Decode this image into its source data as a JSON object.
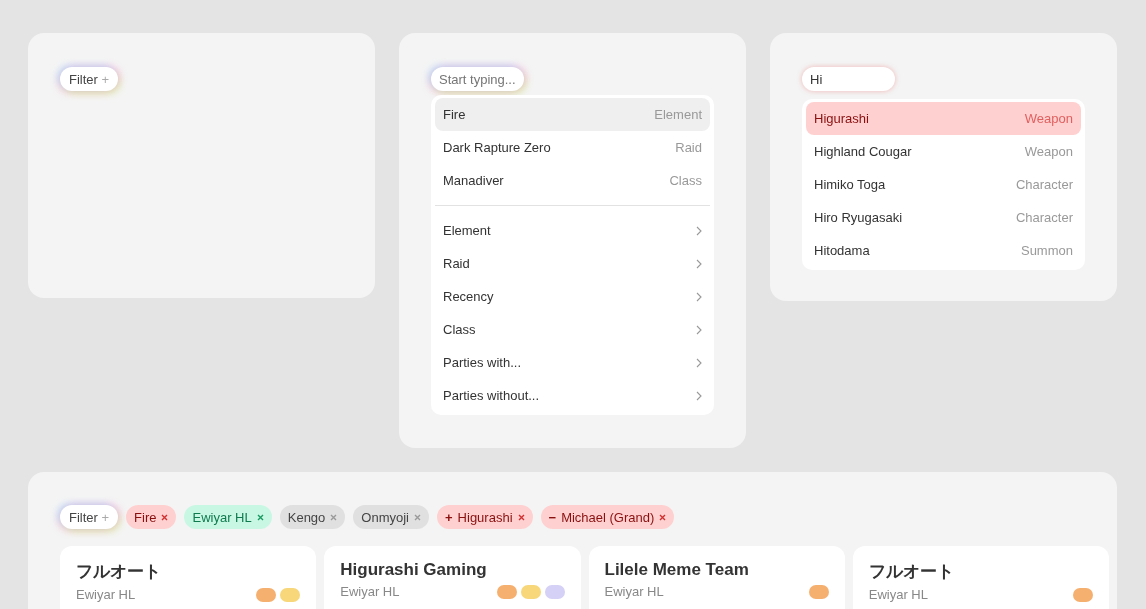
{
  "panel_empty": {
    "filter_button": {
      "label": "Filter",
      "icon": "+"
    }
  },
  "panel_menu": {
    "search": {
      "placeholder": "Start typing..."
    },
    "suggestions": [
      {
        "label": "Fire",
        "category": "Element",
        "selected": true
      },
      {
        "label": "Dark Rapture Zero",
        "category": "Raid",
        "selected": false
      },
      {
        "label": "Manadiver",
        "category": "Class",
        "selected": false
      }
    ],
    "submenus": [
      {
        "label": "Element"
      },
      {
        "label": "Raid"
      },
      {
        "label": "Recency"
      },
      {
        "label": "Class"
      },
      {
        "label": "Parties with..."
      },
      {
        "label": "Parties without..."
      }
    ]
  },
  "panel_results": {
    "search": {
      "value": "Hi"
    },
    "results": [
      {
        "label": "Higurashi",
        "category": "Weapon",
        "selected": true
      },
      {
        "label": "Highland Cougar",
        "category": "Weapon",
        "selected": false
      },
      {
        "label": "Himiko Toga",
        "category": "Character",
        "selected": false
      },
      {
        "label": "Hiro Ryugasaki",
        "category": "Character",
        "selected": false
      },
      {
        "label": "Hitodama",
        "category": "Summon",
        "selected": false
      }
    ]
  },
  "panel_parties": {
    "filter_button": {
      "label": "Filter",
      "icon": "+"
    },
    "chips": [
      {
        "label": "Fire",
        "color": "#ffd0d0"
      },
      {
        "label": "Ewiyar HL",
        "color": "#c8f7e4"
      },
      {
        "label": "Kengo",
        "color": "#e0e0e0"
      },
      {
        "label": "Onmyoji",
        "color": "#e0e0e0"
      },
      {
        "label": "Higurashi",
        "prefix": "+",
        "color": "#ffd0d0"
      },
      {
        "label": "Michael (Grand)",
        "prefix": "−",
        "color": "#ffd0d0"
      }
    ],
    "cards": [
      {
        "title": "フルオート",
        "subtitle": "Ewiyar HL",
        "badges": [
          {
            "color": "#f5b070"
          },
          {
            "color": "#f7d77a"
          }
        ]
      },
      {
        "title": "Higurashi Gaming",
        "subtitle": "Ewiyar HL",
        "badges": [
          {
            "color": "#f5b070"
          },
          {
            "color": "#f7d77a"
          },
          {
            "color": "#d5d0f5"
          }
        ]
      },
      {
        "title": "Lilele Meme Team",
        "subtitle": "Ewiyar HL",
        "badges": [
          {
            "color": "#f5b070"
          }
        ]
      },
      {
        "title": "フルオート",
        "subtitle": "Ewiyar HL",
        "badges": [
          {
            "color": "#f5b070"
          }
        ]
      }
    ]
  }
}
